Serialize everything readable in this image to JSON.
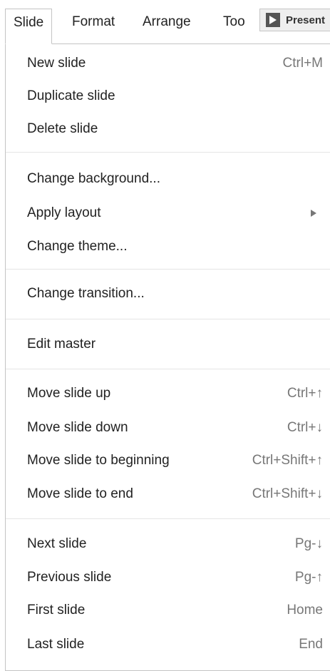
{
  "menubar": {
    "items": [
      {
        "label": "Slide",
        "active": true
      },
      {
        "label": "Format"
      },
      {
        "label": "Arrange"
      },
      {
        "label": "Too"
      }
    ],
    "present_label": "Present"
  },
  "menu": {
    "groups": [
      [
        {
          "label": "New slide",
          "shortcut": "Ctrl+M"
        },
        {
          "label": "Duplicate slide",
          "shortcut": ""
        },
        {
          "label": "Delete slide",
          "shortcut": ""
        }
      ],
      [
        {
          "label": "Change background...",
          "shortcut": ""
        },
        {
          "label": "Apply layout",
          "shortcut": "",
          "submenu": true
        },
        {
          "label": "Change theme...",
          "shortcut": ""
        }
      ],
      [
        {
          "label": "Change transition...",
          "shortcut": ""
        }
      ],
      [
        {
          "label": "Edit master",
          "shortcut": ""
        }
      ],
      [
        {
          "label": "Move slide up",
          "shortcut": "Ctrl+↑"
        },
        {
          "label": "Move slide down",
          "shortcut": "Ctrl+↓"
        },
        {
          "label": "Move slide to beginning",
          "shortcut": "Ctrl+Shift+↑"
        },
        {
          "label": "Move slide to end",
          "shortcut": "Ctrl+Shift+↓"
        }
      ],
      [
        {
          "label": "Next slide",
          "shortcut": "Pg-↓"
        },
        {
          "label": "Previous slide",
          "shortcut": "Pg-↑"
        },
        {
          "label": "First slide",
          "shortcut": "Home"
        },
        {
          "label": "Last slide",
          "shortcut": "End"
        }
      ]
    ]
  }
}
